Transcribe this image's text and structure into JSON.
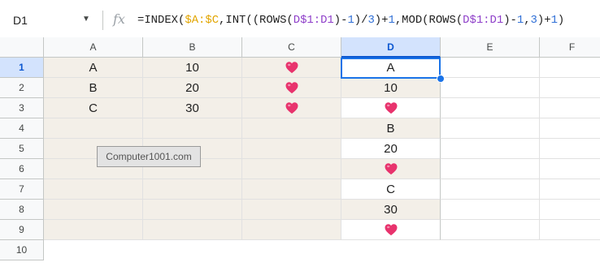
{
  "formula_bar": {
    "cell_reference": "D1",
    "fx_symbol": "fx",
    "formula_parts": [
      {
        "text": "=INDEX(",
        "kind": "plain"
      },
      {
        "text": "$A:$C",
        "kind": "r1"
      },
      {
        "text": ",INT((ROWS(",
        "kind": "plain"
      },
      {
        "text": "D$1:D1",
        "kind": "r2"
      },
      {
        "text": ")-",
        "kind": "plain"
      },
      {
        "text": "1",
        "kind": "num"
      },
      {
        "text": ")/",
        "kind": "plain"
      },
      {
        "text": "3",
        "kind": "num"
      },
      {
        "text": ")+",
        "kind": "plain"
      },
      {
        "text": "1",
        "kind": "num"
      },
      {
        "text": ",MOD(ROWS(",
        "kind": "plain"
      },
      {
        "text": "D$1:D1",
        "kind": "r2"
      },
      {
        "text": ")-",
        "kind": "plain"
      },
      {
        "text": "1",
        "kind": "num"
      },
      {
        "text": ",",
        "kind": "plain"
      },
      {
        "text": "3",
        "kind": "num"
      },
      {
        "text": ")+",
        "kind": "plain"
      },
      {
        "text": "1",
        "kind": "num"
      },
      {
        "text": ")",
        "kind": "plain"
      }
    ]
  },
  "columns": [
    "A",
    "B",
    "C",
    "D",
    "E",
    "F"
  ],
  "active_column": "D",
  "rows": [
    "1",
    "2",
    "3",
    "4",
    "5",
    "6",
    "7",
    "8",
    "9",
    "10"
  ],
  "active_row": "1",
  "cells": {
    "A": [
      "A",
      "B",
      "C",
      "",
      "",
      "",
      "",
      "",
      ""
    ],
    "B": [
      "10",
      "20",
      "30",
      "",
      "",
      "",
      "",
      "",
      ""
    ],
    "C": [
      "heart",
      "heart",
      "heart",
      "",
      "",
      "",
      "",
      "",
      ""
    ],
    "D": [
      "A",
      "10",
      "heart",
      "B",
      "20",
      "heart",
      "C",
      "30",
      "heart"
    ]
  },
  "heart_color": "#e8336d",
  "tooltip_text": "Computer1001.com"
}
